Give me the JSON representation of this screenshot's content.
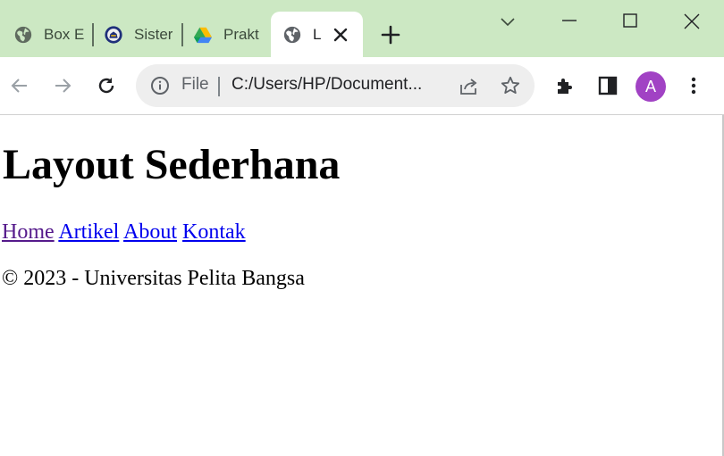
{
  "browser": {
    "tabs": [
      {
        "label": "Box E",
        "icon": "globe-icon"
      },
      {
        "label": "Sister",
        "icon": "university-logo-icon"
      },
      {
        "label": "Prakt",
        "icon": "google-drive-icon"
      },
      {
        "label": "L",
        "icon": "globe-icon",
        "active": true
      }
    ],
    "omnibox": {
      "scheme_label": "File",
      "url": "C:/Users/HP/Document..."
    },
    "profile_initial": "A",
    "colors": {
      "frame": "#cce8c3",
      "avatar": "#a142c4",
      "omnibox": "#eeeeee"
    }
  },
  "page": {
    "title": "Layout Sederhana",
    "nav_links": [
      "Home",
      "Artikel",
      "About",
      "Kontak"
    ],
    "footer": "© 2023 - Universitas Pelita Bangsa",
    "colors": {
      "visited_link": "#551a8b",
      "link": "#0000ee"
    }
  }
}
